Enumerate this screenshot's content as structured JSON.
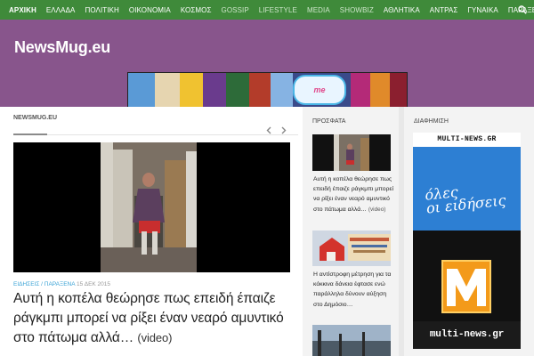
{
  "nav": {
    "items": [
      {
        "label": "ΑΡΧΙΚΗ",
        "active": true
      },
      {
        "label": "ΕΛΛΑΔΑ"
      },
      {
        "label": "ΠΟΛΙΤΙΚΗ"
      },
      {
        "label": "ΟΙΚΟΝΟΜΙΑ"
      },
      {
        "label": "ΚΟΣΜΟΣ"
      },
      {
        "label": "GOSSIP",
        "dim": true
      },
      {
        "label": "LIFESTYLE",
        "dim": true
      },
      {
        "label": "MEDIA",
        "dim": true
      },
      {
        "label": "SHOWBIZ",
        "dim": true
      },
      {
        "label": "ΑΘΛΗΤΙΚΑ"
      },
      {
        "label": "ΑΝΤΡΑΣ"
      },
      {
        "label": "ΓΥΝΑΙΚΑ"
      },
      {
        "label": "ΠΑΡΑΞΕΝΑ"
      },
      {
        "label": "ΥΓΕΙΑ"
      }
    ],
    "search_icon": "search-icon"
  },
  "header": {
    "site_title": "NewsMug.eu",
    "banner_logo": "me"
  },
  "main": {
    "breadcrumb": "NEWSMUG.EU",
    "meta_category": "ΕΙΔΗΣΕΙΣ / ΠΑΡΑΞΕΝΑ",
    "meta_date": "15 ΔΕΚ 2015",
    "headline": "Αυτή η κοπέλα θεώρησε πως επειδή έπαιζε ράγκμπι μπορεί να ρίξει έναν νεαρό αμυντικό στο πάτωμα αλλά…",
    "headline_tail": "(video)"
  },
  "recent": {
    "title": "ΠΡΟΣΦΑΤΑ",
    "posts": [
      {
        "text": "Αυτή η κοπέλα θεώρησε πως επειδή έπαιζε ράγκμπι μπορεί να ρίξει έναν νεαρό αμυντικό στο πάτωμα αλλά…",
        "tail": "(video)"
      },
      {
        "text": "Η αντίστροφη μέτρηση για τα κόκκινα δάνεια έφτασε ενώ παράλληλα δύνουν αύξηση στο Δημόσιο…",
        "tail": ""
      }
    ]
  },
  "ads": {
    "title": "ΔΙΑΦΗΜΙΣΗ",
    "top_text": "MULTI-NEWS.GR",
    "script_line1": "όλες",
    "script_line2": "οι ειδήσεις",
    "bottom_text": "multi-news.gr"
  },
  "colors": {
    "nav_bg": "#3f8a3a",
    "header_bg": "#88558c",
    "meta_link": "#3aa3d6"
  }
}
